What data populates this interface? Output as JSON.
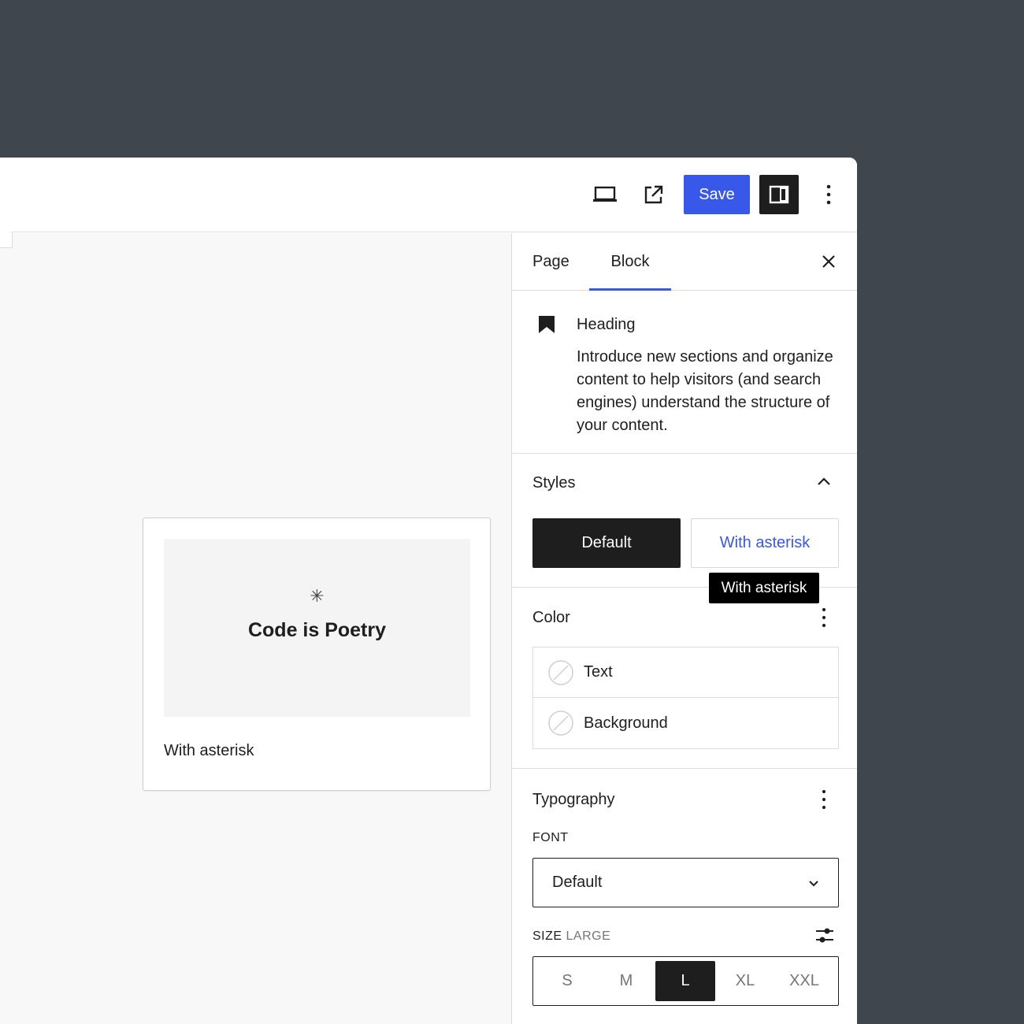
{
  "toolbar": {
    "save_label": "Save"
  },
  "preview": {
    "asterisk": "✳",
    "heading": "Code is Poetry",
    "caption": "With asterisk"
  },
  "sidebar": {
    "tabs": [
      {
        "label": "Page"
      },
      {
        "label": "Block"
      }
    ],
    "block": {
      "title": "Heading",
      "description": "Introduce new sections and organize content to help visitors (and search engines) understand the structure of your content."
    },
    "styles": {
      "title": "Styles",
      "options": [
        {
          "label": "Default",
          "selected": true
        },
        {
          "label": "With asterisk",
          "selected": false
        }
      ],
      "tooltip": "With asterisk"
    },
    "color": {
      "title": "Color",
      "items": [
        {
          "label": "Text"
        },
        {
          "label": "Background"
        }
      ]
    },
    "typography": {
      "title": "Typography",
      "font_label": "FONT",
      "font_value": "Default",
      "size_label": "SIZE",
      "size_hint": "LARGE",
      "sizes": [
        "S",
        "M",
        "L",
        "XL",
        "XXL"
      ],
      "selected_size": "L"
    }
  },
  "colors": {
    "accent": "#3858e9",
    "dark": "#1e1e1e",
    "backdrop": "#3f464e"
  }
}
